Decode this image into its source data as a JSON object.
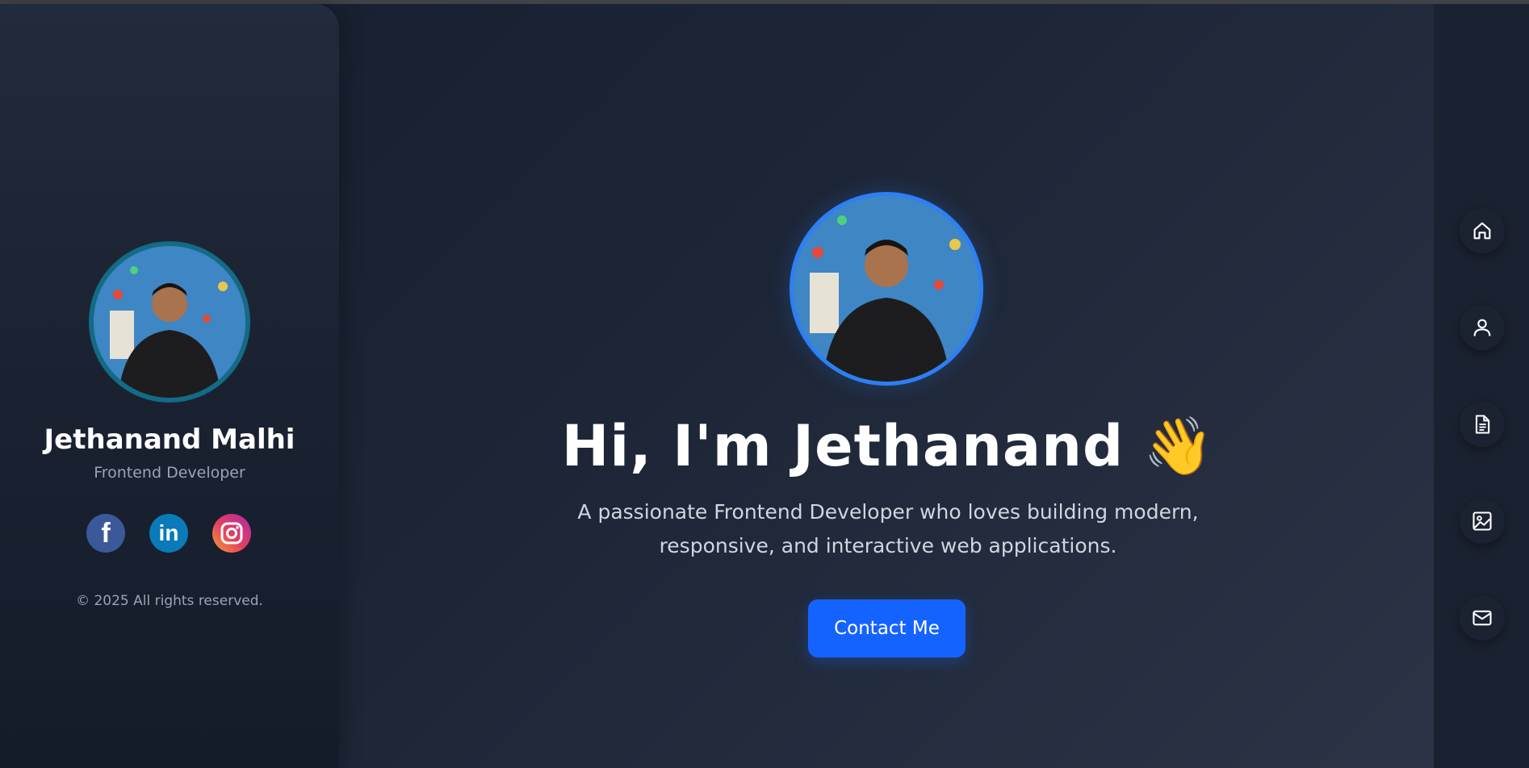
{
  "sidebar": {
    "name": "Jethanand Malhi",
    "role": "Frontend Developer",
    "copyright": "© 2025 All rights reserved.",
    "socials": [
      {
        "icon": "facebook-icon",
        "glyph": "f"
      },
      {
        "icon": "linkedin-icon",
        "glyph": "in"
      },
      {
        "icon": "instagram-icon"
      }
    ]
  },
  "hero": {
    "title": "Hi, I'm Jethanand",
    "wave_emoji": "👋",
    "description": "A passionate Frontend Developer who loves building modern, responsive, and interactive web applications.",
    "cta_label": "Contact Me"
  },
  "nav": {
    "items": [
      {
        "icon": "home-icon"
      },
      {
        "icon": "user-icon"
      },
      {
        "icon": "document-icon"
      },
      {
        "icon": "image-icon"
      },
      {
        "icon": "mail-icon"
      }
    ]
  },
  "colors": {
    "accent": "#1563ff",
    "avatar_ring_sidebar": "#136b85",
    "avatar_ring_hero": "#2c7ff5",
    "background": "#1b2333"
  }
}
